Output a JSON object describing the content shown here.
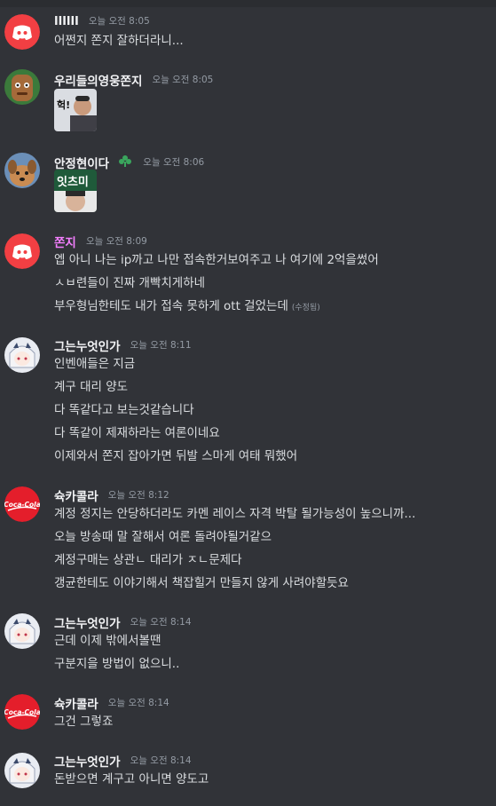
{
  "messages": [
    {
      "user": "llllll",
      "time": "오늘 오전 8:05",
      "avatar": "discord-logo-icon",
      "lines": [
        "어쩐지 쫀지 잘하더라니..."
      ]
    },
    {
      "user": "우리들의영웅쫀지",
      "time": "오늘 오전 8:05",
      "avatar": "brown-character-avatar",
      "sticker_caption": "헉!"
    },
    {
      "user": "안정현이다",
      "time": "오늘 오전 8:06",
      "avatar": "dog-avatar",
      "badge": "clover-icon",
      "sticker_caption": "잇츠미"
    },
    {
      "user": "쫀지",
      "time": "오늘 오전 8:09",
      "avatar": "discord-logo-icon",
      "lines": [
        "엡 아니 나는 ip까고 나만 접속한거보여주고 나 여기에 2억을썼어",
        "ㅅㅂ련들이 진짜 개빡치게하네",
        "부우형님한테도 내가 접속 못하게 ott  걸었는데"
      ],
      "edited": "(수정됨)"
    },
    {
      "user": "그는누엇인가",
      "time": "오늘 오전 8:11",
      "avatar": "anime-girl-avatar",
      "lines": [
        "인벤애들은 지금",
        "계구 대리 양도",
        "다 똑같다고 보는것같습니다",
        "다 똑같이 제재하라는 여론이네요",
        "이제와서 쫀지 잡아가면 뒤발 스마게 여태 뭐했어"
      ]
    },
    {
      "user": "슉카콜라",
      "time": "오늘 오전 8:12",
      "avatar": "coca-cola-logo",
      "lines": [
        "계정 정지는 안당하더라도 카멘 레이스 자격 박탈 될가능성이 높으니까...",
        "오늘 방송때 말 잘해서 여론 돌려야될거같으",
        "계정구매는 상관ㄴ 대리가 ㅈㄴ문제다",
        "갱균한테도 이야기해서 책잡힐거 만들지 않게 사려야할듯요"
      ]
    },
    {
      "user": "그는누엇인가",
      "time": "오늘 오전 8:14",
      "avatar": "anime-girl-avatar",
      "lines": [
        "근데 이제 밖에서볼땐",
        "구분지을 방법이 없으니.."
      ]
    },
    {
      "user": "슉카콜라",
      "time": "오늘 오전 8:14",
      "avatar": "coca-cola-logo",
      "lines": [
        "그건 그렇죠"
      ]
    },
    {
      "user": "그는누엇인가",
      "time": "오늘 오전 8:14",
      "avatar": "anime-girl-avatar",
      "lines": [
        "돈받으면 계구고 아니면 양도고"
      ]
    }
  ],
  "logo_text": "Coca-Cola",
  "colors": {
    "background": "#313338",
    "discord_red": "#f23f43",
    "coca_cola_red": "#e41e2b",
    "username_pink": "#f47fff"
  }
}
